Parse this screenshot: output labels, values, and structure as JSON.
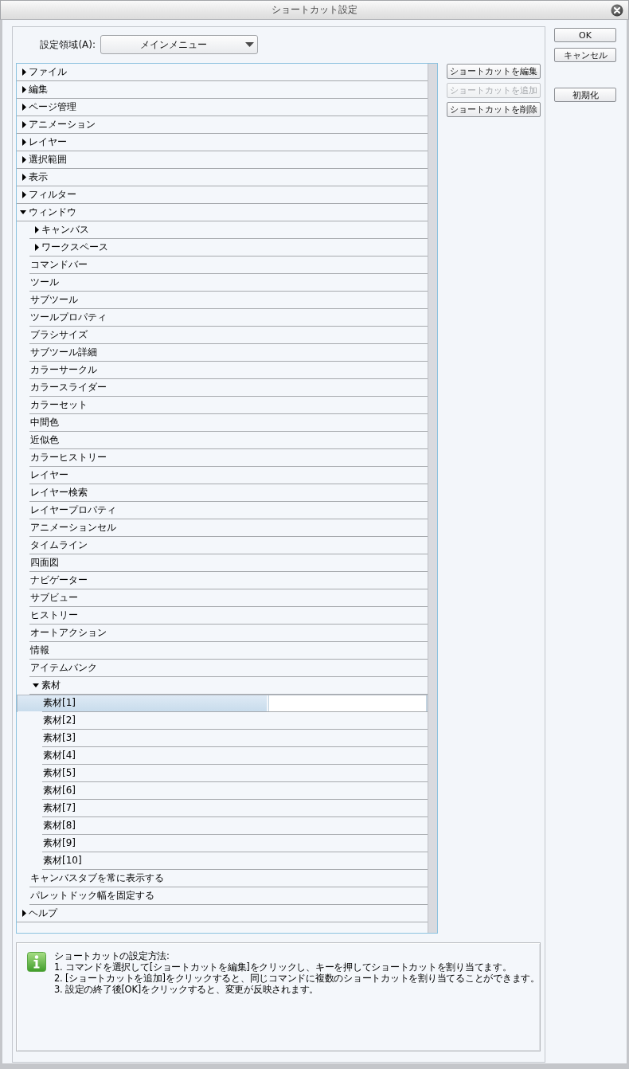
{
  "window": {
    "title": "ショートカット設定"
  },
  "settings_area": {
    "label": "設定領域(A):",
    "value": "メインメニュー"
  },
  "tree": {
    "items": [
      {
        "label": "ファイル",
        "kind": "group",
        "expanded": false,
        "selected": false
      },
      {
        "label": "編集",
        "kind": "group",
        "expanded": false,
        "selected": false
      },
      {
        "label": "ページ管理",
        "kind": "group",
        "expanded": false,
        "selected": false
      },
      {
        "label": "アニメーション",
        "kind": "group",
        "expanded": false,
        "selected": false
      },
      {
        "label": "レイヤー",
        "kind": "group",
        "expanded": false,
        "selected": false
      },
      {
        "label": "選択範囲",
        "kind": "group",
        "expanded": false,
        "selected": false
      },
      {
        "label": "表示",
        "kind": "group",
        "expanded": false,
        "selected": false
      },
      {
        "label": "フィルター",
        "kind": "group",
        "expanded": false,
        "selected": false
      },
      {
        "label": "ウィンドウ",
        "kind": "group",
        "expanded": true,
        "selected": false,
        "children": [
          {
            "label": "キャンバス",
            "kind": "group",
            "expanded": false,
            "selected": false
          },
          {
            "label": "ワークスペース",
            "kind": "group",
            "expanded": false,
            "selected": false
          },
          {
            "label": "コマンドバー",
            "kind": "command",
            "selected": false
          },
          {
            "label": "ツール",
            "kind": "command",
            "selected": false
          },
          {
            "label": "サブツール",
            "kind": "command",
            "selected": false
          },
          {
            "label": "ツールプロパティ",
            "kind": "command",
            "selected": false
          },
          {
            "label": "ブラシサイズ",
            "kind": "command",
            "selected": false
          },
          {
            "label": "サブツール詳細",
            "kind": "command",
            "selected": false
          },
          {
            "label": "カラーサークル",
            "kind": "command",
            "selected": false
          },
          {
            "label": "カラースライダー",
            "kind": "command",
            "selected": false
          },
          {
            "label": "カラーセット",
            "kind": "command",
            "selected": false
          },
          {
            "label": "中間色",
            "kind": "command",
            "selected": false
          },
          {
            "label": "近似色",
            "kind": "command",
            "selected": false
          },
          {
            "label": "カラーヒストリー",
            "kind": "command",
            "selected": false
          },
          {
            "label": "レイヤー",
            "kind": "command",
            "selected": false
          },
          {
            "label": "レイヤー検索",
            "kind": "command",
            "selected": false
          },
          {
            "label": "レイヤープロパティ",
            "kind": "command",
            "selected": false
          },
          {
            "label": "アニメーションセル",
            "kind": "command",
            "selected": false
          },
          {
            "label": "タイムライン",
            "kind": "command",
            "selected": false
          },
          {
            "label": "四面図",
            "kind": "command",
            "selected": false
          },
          {
            "label": "ナビゲーター",
            "kind": "command",
            "selected": false
          },
          {
            "label": "サブビュー",
            "kind": "command",
            "selected": false
          },
          {
            "label": "ヒストリー",
            "kind": "command",
            "selected": false
          },
          {
            "label": "オートアクション",
            "kind": "command",
            "selected": false
          },
          {
            "label": "情報",
            "kind": "command",
            "selected": false
          },
          {
            "label": "アイテムバンク",
            "kind": "command",
            "selected": false
          },
          {
            "label": "素材",
            "kind": "group",
            "expanded": true,
            "selected": false,
            "children": [
              {
                "label": "素材[1]",
                "kind": "command",
                "selected": true
              },
              {
                "label": "素材[2]",
                "kind": "command",
                "selected": false
              },
              {
                "label": "素材[3]",
                "kind": "command",
                "selected": false
              },
              {
                "label": "素材[4]",
                "kind": "command",
                "selected": false
              },
              {
                "label": "素材[5]",
                "kind": "command",
                "selected": false
              },
              {
                "label": "素材[6]",
                "kind": "command",
                "selected": false
              },
              {
                "label": "素材[7]",
                "kind": "command",
                "selected": false
              },
              {
                "label": "素材[8]",
                "kind": "command",
                "selected": false
              },
              {
                "label": "素材[9]",
                "kind": "command",
                "selected": false
              },
              {
                "label": "素材[10]",
                "kind": "command",
                "selected": false
              }
            ]
          },
          {
            "label": "キャンバスタブを常に表示する",
            "kind": "command",
            "selected": false
          },
          {
            "label": "パレットドック幅を固定する",
            "kind": "command",
            "selected": false
          }
        ]
      },
      {
        "label": "ヘルプ",
        "kind": "group",
        "expanded": false,
        "selected": false
      }
    ]
  },
  "edit_buttons": [
    {
      "label": "ショートカットを編集",
      "disabled": false
    },
    {
      "label": "ショートカットを追加",
      "disabled": true
    },
    {
      "label": "ショートカットを削除",
      "disabled": false
    }
  ],
  "dialog_buttons": [
    {
      "label": "OK"
    },
    {
      "label": "キャンセル"
    }
  ],
  "reset_button": {
    "label": "初期化"
  },
  "info": {
    "heading": "ショートカットの設定方法:",
    "steps": [
      "1. コマンドを選択して[ショートカットを編集]をクリックし、キーを押してショートカットを割り当てます。",
      "2. [ショートカットを追加]をクリックすると、同じコマンドに複数のショートカットを割り当てることができます。",
      "3. 設定の終了後[OK]をクリックすると、変更が反映されます。"
    ]
  }
}
